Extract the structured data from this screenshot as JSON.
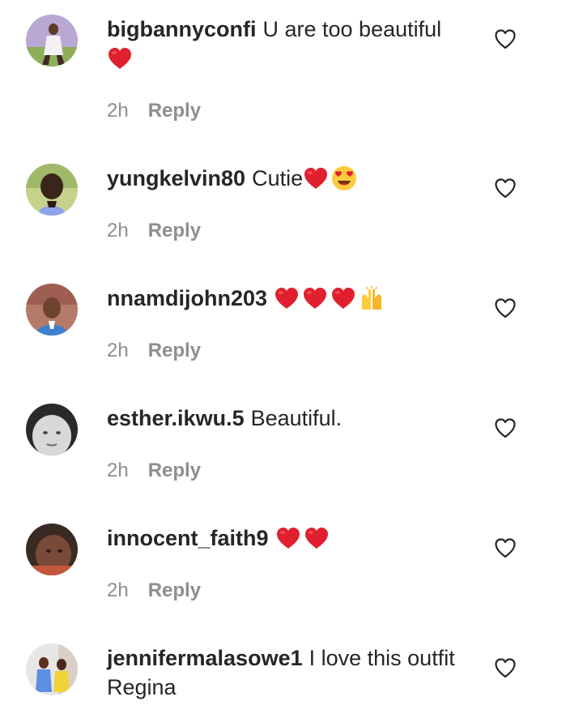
{
  "comments": [
    {
      "username": "bigbannyconfi",
      "text": "U are too beautiful",
      "emojis": [
        "red-heart"
      ],
      "time": "2h",
      "reply_label": "Reply"
    },
    {
      "username": "yungkelvin80",
      "text": "Cutie",
      "emojis": [
        "red-heart",
        "heart-eyes"
      ],
      "time": "2h",
      "reply_label": "Reply"
    },
    {
      "username": "nnamdijohn203",
      "text": "",
      "emojis": [
        "red-heart",
        "red-heart",
        "red-heart",
        "raising-hands"
      ],
      "time": "2h",
      "reply_label": "Reply"
    },
    {
      "username": "esther.ikwu.5",
      "text": "Beautiful.",
      "emojis": [],
      "time": "2h",
      "reply_label": "Reply"
    },
    {
      "username": "innocent_faith9",
      "text": "",
      "emojis": [
        "red-heart",
        "red-heart"
      ],
      "time": "2h",
      "reply_label": "Reply"
    },
    {
      "username": "jennifermalasowe1",
      "text": "I love this outfit Regina",
      "emojis": [],
      "time": "",
      "reply_label": ""
    }
  ],
  "icons": {
    "like": "heart-outline-icon"
  },
  "colors": {
    "text": "#262626",
    "secondary": "#8e8e8e",
    "emoji_heart": "#e0202e"
  }
}
